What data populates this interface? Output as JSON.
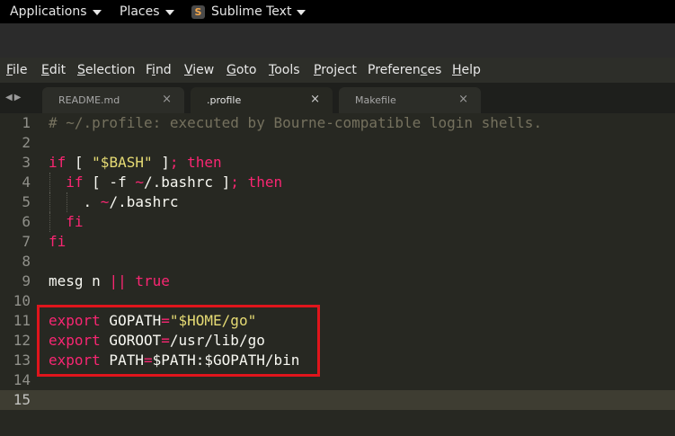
{
  "topbar": {
    "applications": "Applications",
    "places": "Places",
    "app_icon_letter": "S",
    "app_name": "Sublime Text"
  },
  "menubar": [
    {
      "label": "File",
      "mn": 0
    },
    {
      "label": "Edit",
      "mn": 0
    },
    {
      "label": "Selection",
      "mn": 0
    },
    {
      "label": "Find",
      "mn": 1
    },
    {
      "label": "View",
      "mn": 0
    },
    {
      "label": "Goto",
      "mn": 0
    },
    {
      "label": "Tools",
      "mn": 0
    },
    {
      "label": "Project",
      "mn": 0
    },
    {
      "label": "Preferences",
      "mn": 8
    },
    {
      "label": "Help",
      "mn": 0
    }
  ],
  "tabs": [
    {
      "label": "README.md",
      "active": false
    },
    {
      "label": ".profile",
      "active": true
    },
    {
      "label": "Makefile",
      "active": false
    }
  ],
  "tab_close_glyph": "×",
  "nav_arrows": "◀▶",
  "lines": [
    {
      "n": "1",
      "tokens": [
        {
          "t": "# ~/.profile: executed by Bourne-compatible login shells.",
          "c": "comment"
        }
      ]
    },
    {
      "n": "2",
      "tokens": []
    },
    {
      "n": "3",
      "tokens": [
        {
          "t": "if",
          "c": "kw"
        },
        {
          "t": " [ ",
          "c": "plain"
        },
        {
          "t": "\"$BASH\"",
          "c": "str"
        },
        {
          "t": " ]",
          "c": "plain"
        },
        {
          "t": ";",
          "c": "kw"
        },
        {
          "t": " ",
          "c": "plain"
        },
        {
          "t": "then",
          "c": "kw"
        }
      ]
    },
    {
      "n": "4",
      "tokens": [
        {
          "t": "  ",
          "c": "plain"
        },
        {
          "t": "if",
          "c": "kw"
        },
        {
          "t": " [ -f ",
          "c": "plain"
        },
        {
          "t": "~",
          "c": "kw"
        },
        {
          "t": "/.bashrc ]",
          "c": "plain"
        },
        {
          "t": ";",
          "c": "kw"
        },
        {
          "t": " ",
          "c": "plain"
        },
        {
          "t": "then",
          "c": "kw"
        }
      ]
    },
    {
      "n": "5",
      "tokens": [
        {
          "t": "    . ",
          "c": "plain"
        },
        {
          "t": "~",
          "c": "kw"
        },
        {
          "t": "/.bashrc",
          "c": "plain"
        }
      ]
    },
    {
      "n": "6",
      "tokens": [
        {
          "t": "  ",
          "c": "plain"
        },
        {
          "t": "fi",
          "c": "kw"
        }
      ]
    },
    {
      "n": "7",
      "tokens": [
        {
          "t": "fi",
          "c": "kw"
        }
      ]
    },
    {
      "n": "8",
      "tokens": []
    },
    {
      "n": "9",
      "tokens": [
        {
          "t": "mesg n ",
          "c": "plain"
        },
        {
          "t": "||",
          "c": "kw"
        },
        {
          "t": " ",
          "c": "plain"
        },
        {
          "t": "true",
          "c": "kw"
        }
      ]
    },
    {
      "n": "10",
      "tokens": []
    },
    {
      "n": "11",
      "tokens": [
        {
          "t": "export",
          "c": "kw"
        },
        {
          "t": " GOPATH",
          "c": "plain"
        },
        {
          "t": "=",
          "c": "kw"
        },
        {
          "t": "\"$HOME/go\"",
          "c": "str"
        }
      ]
    },
    {
      "n": "12",
      "tokens": [
        {
          "t": "export",
          "c": "kw"
        },
        {
          "t": " GOROOT",
          "c": "plain"
        },
        {
          "t": "=",
          "c": "kw"
        },
        {
          "t": "/usr/lib/go",
          "c": "plain"
        }
      ]
    },
    {
      "n": "13",
      "tokens": [
        {
          "t": "export",
          "c": "kw"
        },
        {
          "t": " PATH",
          "c": "plain"
        },
        {
          "t": "=",
          "c": "kw"
        },
        {
          "t": "$PATH:$GOPATH/bin",
          "c": "plain"
        }
      ]
    },
    {
      "n": "14",
      "tokens": []
    },
    {
      "n": "15",
      "tokens": [],
      "current": true
    }
  ],
  "colors": {
    "background": "#272822",
    "keyword": "#f92672",
    "string": "#e6db74",
    "comment": "#75715e",
    "highlight_box": "#e0151c"
  }
}
